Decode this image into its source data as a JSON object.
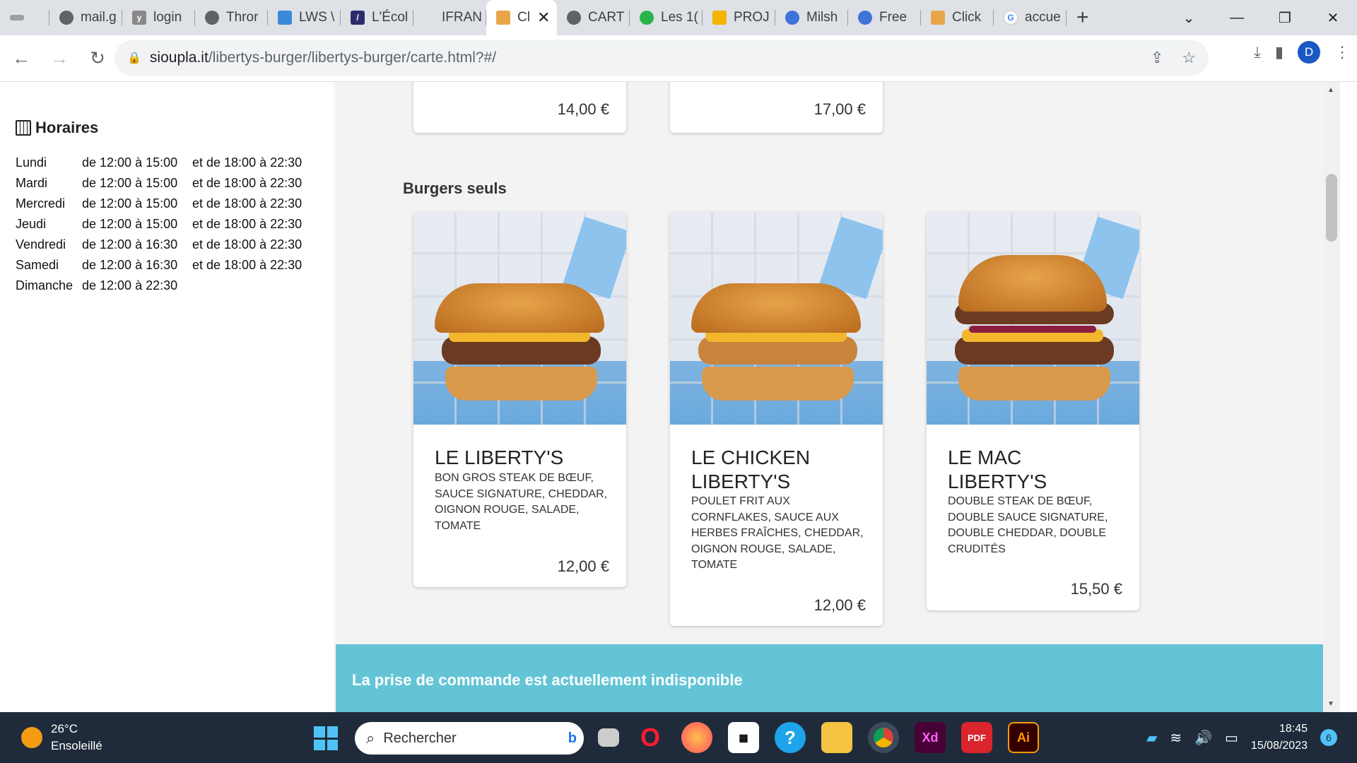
{
  "browser": {
    "tabs": [
      {
        "label": "",
        "icon": "tab-bar-icon"
      },
      {
        "label": "mail.g",
        "icon": "globe-icon"
      },
      {
        "label": "login",
        "icon": "y-icon"
      },
      {
        "label": "Thror",
        "icon": "globe-icon"
      },
      {
        "label": "LWS \\",
        "icon": "lws-icon"
      },
      {
        "label": "L'Écol",
        "icon": "slash-icon"
      },
      {
        "label": "IFRAN",
        "icon": ""
      },
      {
        "label": "Cl",
        "icon": "burger-icon",
        "active": true
      },
      {
        "label": "CART",
        "icon": "globe-icon"
      },
      {
        "label": "Les 1(",
        "icon": "green-icon"
      },
      {
        "label": "PROJ",
        "icon": "slides-icon"
      },
      {
        "label": "Milsh",
        "icon": "robot-icon"
      },
      {
        "label": "Free",
        "icon": "robot-icon"
      },
      {
        "label": "Click",
        "icon": "burger-icon"
      },
      {
        "label": "accue",
        "icon": "google-icon"
      }
    ],
    "url_host": "sioupla.it",
    "url_path": "/libertys-burger/libertys-burger/carte.html?#/",
    "avatar_letter": "D"
  },
  "sidebar": {
    "hours_title": "Horaires",
    "hours": [
      {
        "day": "Lundi",
        "r1": "de 12:00 à 15:00",
        "r2": "et de 18:00 à 22:30"
      },
      {
        "day": "Mardi",
        "r1": "de 12:00 à 15:00",
        "r2": "et de 18:00 à 22:30"
      },
      {
        "day": "Mercredi",
        "r1": "de 12:00 à 15:00",
        "r2": "et de 18:00 à 22:30"
      },
      {
        "day": "Jeudi",
        "r1": "de 12:00 à 15:00",
        "r2": "et de 18:00 à 22:30"
      },
      {
        "day": "Vendredi",
        "r1": "de 12:00 à 16:30",
        "r2": "et de 18:00 à 22:30"
      },
      {
        "day": "Samedi",
        "r1": "de 12:00 à 16:30",
        "r2": "et de 18:00 à 22:30"
      },
      {
        "day": "Dimanche",
        "r1": "de 12:00 à 22:30",
        "r2": ""
      }
    ]
  },
  "menu": {
    "prev_prices": [
      "14,00 €",
      "17,00 €"
    ],
    "section_title": "Burgers seuls",
    "items": [
      {
        "name": "LE LIBERTY'S",
        "desc": "BON GROS STEAK DE BŒUF, SAUCE SIGNATURE, CHEDDAR, OIGNON ROUGE, SALADE, TOMATE",
        "price": "12,00 €"
      },
      {
        "name": "LE CHICKEN LIBERTY'S",
        "desc": "POULET FRIT AUX CORNFLAKES, SAUCE AUX HERBES FRAÎCHES, CHEDDAR, OIGNON ROUGE, SALADE, TOMATE",
        "price": "12,00 €"
      },
      {
        "name": "LE MAC LIBERTY'S",
        "desc": "DOUBLE STEAK DE BŒUF, DOUBLE SAUCE SIGNATURE, DOUBLE CHEDDAR, DOUBLE CRUDITÉS",
        "price": "15,50 €"
      }
    ],
    "banner": "La prise de commande est actuellement indisponible"
  },
  "taskbar": {
    "temp": "26°C",
    "weather": "Ensoleillé",
    "search_placeholder": "Rechercher",
    "time": "18:45",
    "date": "15/08/2023",
    "notif_count": "6",
    "apps": [
      "task-view",
      "opera",
      "firefox",
      "store",
      "help",
      "explorer",
      "chrome",
      "Xd",
      "PDF",
      "Ai"
    ]
  },
  "colors": {
    "banner": "#63c4d6",
    "accent": "#1a58c4"
  }
}
